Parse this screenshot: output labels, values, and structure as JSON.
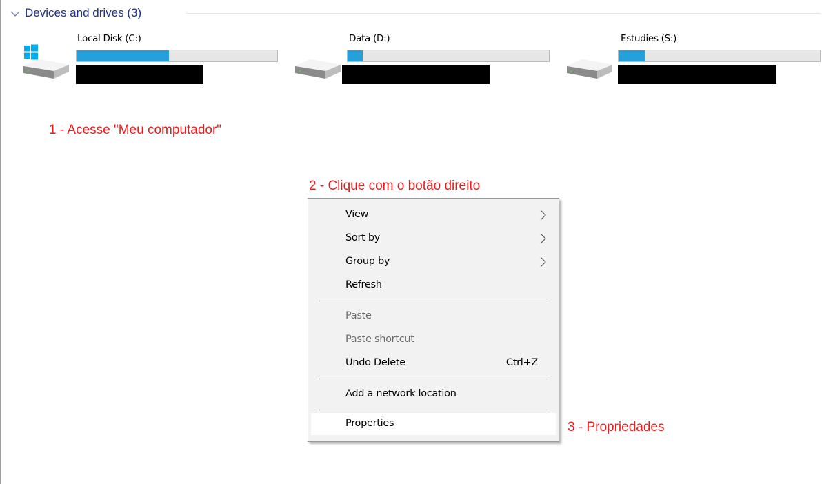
{
  "group": {
    "title": "Devices and drives (3)"
  },
  "drives": [
    {
      "name": "Local Disk (C:)",
      "used_fraction": 0.46,
      "os_drive": true
    },
    {
      "name": "Data (D:)",
      "used_fraction": 0.075,
      "os_drive": false
    },
    {
      "name": "Estudies (S:)",
      "used_fraction": 0.13,
      "os_drive": false
    }
  ],
  "annotations": {
    "step1": "1 - Acesse \"Meu computador\"",
    "step2": "2 - Clique com o botão direito",
    "step3": "3 - Propriedades"
  },
  "context_menu": {
    "items": [
      {
        "label": "View",
        "submenu": true,
        "enabled": true
      },
      {
        "label": "Sort by",
        "submenu": true,
        "enabled": true
      },
      {
        "label": "Group by",
        "submenu": true,
        "enabled": true
      },
      {
        "label": "Refresh",
        "enabled": true
      },
      {
        "label": "Paste",
        "enabled": false
      },
      {
        "label": "Paste shortcut",
        "enabled": false
      },
      {
        "label": "Undo Delete",
        "shortcut": "Ctrl+Z",
        "enabled": true
      },
      {
        "label": "Add a network location",
        "enabled": true
      },
      {
        "label": "Properties",
        "enabled": true,
        "highlighted": true
      }
    ]
  },
  "colors": {
    "header_text": "#1e3287",
    "usage_bar": "#26a0da",
    "annotation": "#ef1a1a",
    "windows_logo": "#00adef"
  },
  "icons": [
    "chevron-down-icon",
    "hard-drive-icon",
    "windows-logo-icon",
    "chevron-right-icon"
  ]
}
